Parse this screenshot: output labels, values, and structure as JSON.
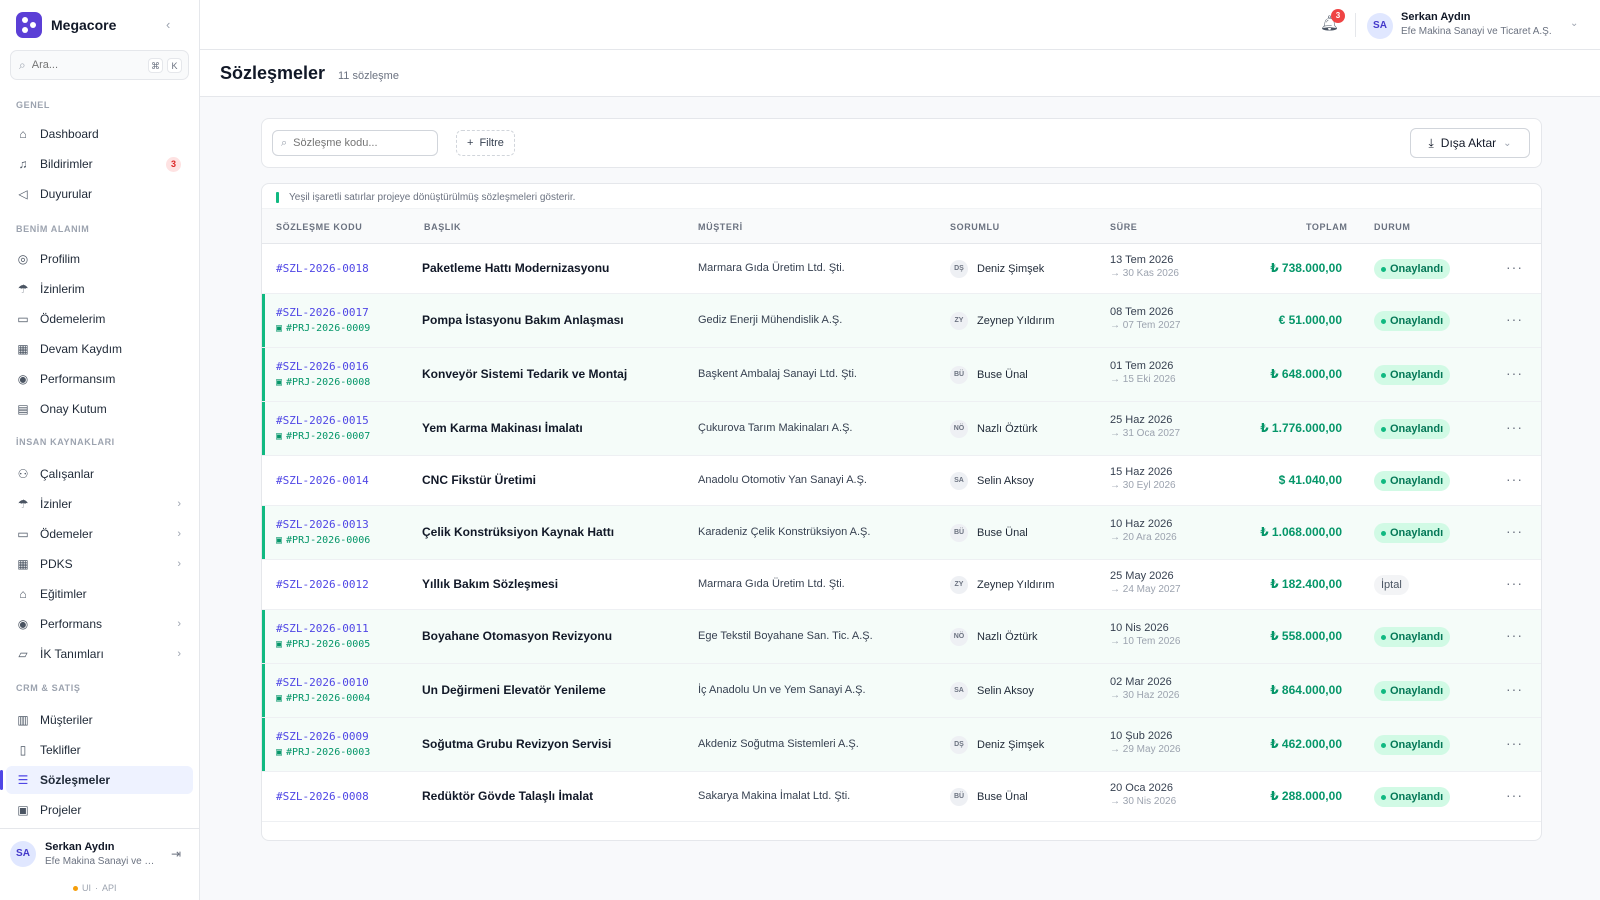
{
  "app": {
    "name": "Megacore"
  },
  "sidebar": {
    "search_placeholder": "Ara...",
    "shortcut": [
      "⌘",
      "K"
    ],
    "groups": [
      {
        "label": "GENEL",
        "items": [
          {
            "label": "Dashboard",
            "icon": "home-icon"
          },
          {
            "label": "Bildirimler",
            "icon": "bell-icon",
            "badge": "3"
          },
          {
            "label": "Duyurular",
            "icon": "megaphone-icon"
          }
        ]
      },
      {
        "label": "BENİM ALANIM",
        "items": [
          {
            "label": "Profilim",
            "icon": "user-circle-icon"
          },
          {
            "label": "İzinlerim",
            "icon": "umbrella-icon"
          },
          {
            "label": "Ödemelerim",
            "icon": "wallet-icon"
          },
          {
            "label": "Devam Kaydım",
            "icon": "calendar-icon"
          },
          {
            "label": "Performansım",
            "icon": "target-icon"
          },
          {
            "label": "Onay Kutum",
            "icon": "inbox-icon"
          }
        ]
      },
      {
        "label": "İNSAN KAYNAKLARI",
        "items": [
          {
            "label": "Çalışanlar",
            "icon": "users-icon"
          },
          {
            "label": "İzinler",
            "icon": "umbrella-icon"
          },
          {
            "label": "Ödemeler",
            "icon": "wallet-icon"
          },
          {
            "label": "PDKS",
            "icon": "calendar-icon"
          },
          {
            "label": "Eğitimler",
            "icon": "graduation-cap-icon"
          },
          {
            "label": "Performans",
            "icon": "target-icon"
          },
          {
            "label": "İK Tanımları",
            "icon": "folder-icon"
          }
        ]
      },
      {
        "label": "CRM & SATIŞ",
        "items": [
          {
            "label": "Müşteriler",
            "icon": "building-icon"
          },
          {
            "label": "Teklifler",
            "icon": "file-icon"
          },
          {
            "label": "Sözleşmeler",
            "icon": "file-text-icon",
            "active": true
          },
          {
            "label": "Projeler",
            "icon": "briefcase-icon"
          }
        ]
      }
    ],
    "footer": {
      "initials": "SA",
      "name": "Serkan Aydın",
      "org": "Efe Makina Sanayi ve Ticaret A.Ş.",
      "status_ui": "UI",
      "status_sep": "·",
      "status_api": "API"
    }
  },
  "topbar": {
    "notifications": "3",
    "user": {
      "initials": "SA",
      "name": "Serkan Aydın",
      "org": "Efe Makina Sanayi ve Ticaret A.Ş."
    }
  },
  "page": {
    "title": "Sözleşmeler",
    "count": "11 sözleşme"
  },
  "toolbar": {
    "search_placeholder": "Sözleşme kodu...",
    "filter_label": "Filtre",
    "export_label": "Dışa Aktar"
  },
  "table": {
    "hint": "Yeşil işaretli satırlar projeye dönüştürülmüş sözleşmeleri gösterir.",
    "columns": {
      "code": "SÖZLEŞME KODU",
      "title": "BAŞLIK",
      "customer": "MÜŞTERİ",
      "owner": "SORUMLU",
      "period": "SÜRE",
      "total": "TOPLAM",
      "status": "DURUM"
    },
    "rows": [
      {
        "code": "#SZL-2026-0018",
        "project": "",
        "title": "Paketleme Hattı Modernizasyonu",
        "customer": "Marmara Gıda Üretim Ltd. Şti.",
        "initials": "DŞ",
        "owner": "Deniz Şimşek",
        "start": "13 Tem 2026",
        "end": "→ 30 Kas 2026",
        "total": "₺ 738.000,00",
        "status": "Onaylandı",
        "status_type": "ok"
      },
      {
        "code": "#SZL-2026-0017",
        "project": "#PRJ-2026-0009",
        "title": "Pompa İstasyonu Bakım Anlaşması",
        "customer": "Gediz Enerji Mühendislik A.Ş.",
        "initials": "ZY",
        "owner": "Zeynep Yıldırım",
        "start": "08 Tem 2026",
        "end": "→ 07 Tem 2027",
        "total": "€ 51.000,00",
        "status": "Onaylandı",
        "status_type": "ok"
      },
      {
        "code": "#SZL-2026-0016",
        "project": "#PRJ-2026-0008",
        "title": "Konveyör Sistemi Tedarik ve Montaj",
        "customer": "Başkent Ambalaj Sanayi Ltd. Şti.",
        "initials": "BÜ",
        "owner": "Buse Ünal",
        "start": "01 Tem 2026",
        "end": "→ 15 Eki 2026",
        "total": "₺ 648.000,00",
        "status": "Onaylandı",
        "status_type": "ok"
      },
      {
        "code": "#SZL-2026-0015",
        "project": "#PRJ-2026-0007",
        "title": "Yem Karma Makinası İmalatı",
        "customer": "Çukurova Tarım Makinaları A.Ş.",
        "initials": "NÖ",
        "owner": "Nazlı Öztürk",
        "start": "25 Haz 2026",
        "end": "→ 31 Oca 2027",
        "total": "₺ 1.776.000,00",
        "status": "Onaylandı",
        "status_type": "ok"
      },
      {
        "code": "#SZL-2026-0014",
        "project": "",
        "title": "CNC Fikstür Üretimi",
        "customer": "Anadolu Otomotiv Yan Sanayi A.Ş.",
        "initials": "SA",
        "owner": "Selin Aksoy",
        "start": "15 Haz 2026",
        "end": "→ 30 Eyl 2026",
        "total": "$ 41.040,00",
        "status": "Onaylandı",
        "status_type": "ok"
      },
      {
        "code": "#SZL-2026-0013",
        "project": "#PRJ-2026-0006",
        "title": "Çelik Konstrüksiyon Kaynak Hattı",
        "customer": "Karadeniz Çelik Konstrüksiyon A.Ş.",
        "initials": "BÜ",
        "owner": "Buse Ünal",
        "start": "10 Haz 2026",
        "end": "→ 20 Ara 2026",
        "total": "₺ 1.068.000,00",
        "status": "Onaylandı",
        "status_type": "ok"
      },
      {
        "code": "#SZL-2026-0012",
        "project": "",
        "title": "Yıllık Bakım Sözleşmesi",
        "customer": "Marmara Gıda Üretim Ltd. Şti.",
        "initials": "ZY",
        "owner": "Zeynep Yıldırım",
        "start": "25 May 2026",
        "end": "→ 24 May 2027",
        "total": "₺ 182.400,00",
        "status": "İptal",
        "status_type": "cancel"
      },
      {
        "code": "#SZL-2026-0011",
        "project": "#PRJ-2026-0005",
        "title": "Boyahane Otomasyon Revizyonu",
        "customer": "Ege Tekstil Boyahane San. Tic. A.Ş.",
        "initials": "NÖ",
        "owner": "Nazlı Öztürk",
        "start": "10 Nis 2026",
        "end": "→ 10 Tem 2026",
        "total": "₺ 558.000,00",
        "status": "Onaylandı",
        "status_type": "ok"
      },
      {
        "code": "#SZL-2026-0010",
        "project": "#PRJ-2026-0004",
        "title": "Un Değirmeni Elevatör Yenileme",
        "customer": "İç Anadolu Un ve Yem Sanayi A.Ş.",
        "initials": "SA",
        "owner": "Selin Aksoy",
        "start": "02 Mar 2026",
        "end": "→ 30 Haz 2026",
        "total": "₺ 864.000,00",
        "status": "Onaylandı",
        "status_type": "ok"
      },
      {
        "code": "#SZL-2026-0009",
        "project": "#PRJ-2026-0003",
        "title": "Soğutma Grubu Revizyon Servisi",
        "customer": "Akdeniz Soğutma Sistemleri A.Ş.",
        "initials": "DŞ",
        "owner": "Deniz Şimşek",
        "start": "10 Şub 2026",
        "end": "→ 29 May 2026",
        "total": "₺ 462.000,00",
        "status": "Onaylandı",
        "status_type": "ok"
      },
      {
        "code": "#SZL-2026-0008",
        "project": "",
        "title": "Redüktör Gövde Talaşlı İmalat",
        "customer": "Sakarya Makina İmalat Ltd. Şti.",
        "initials": "BÜ",
        "owner": "Buse Ünal",
        "start": "20 Oca 2026",
        "end": "→ 30 Nis 2026",
        "total": "₺ 288.000,00",
        "status": "Onaylandı",
        "status_type": "ok"
      }
    ]
  }
}
